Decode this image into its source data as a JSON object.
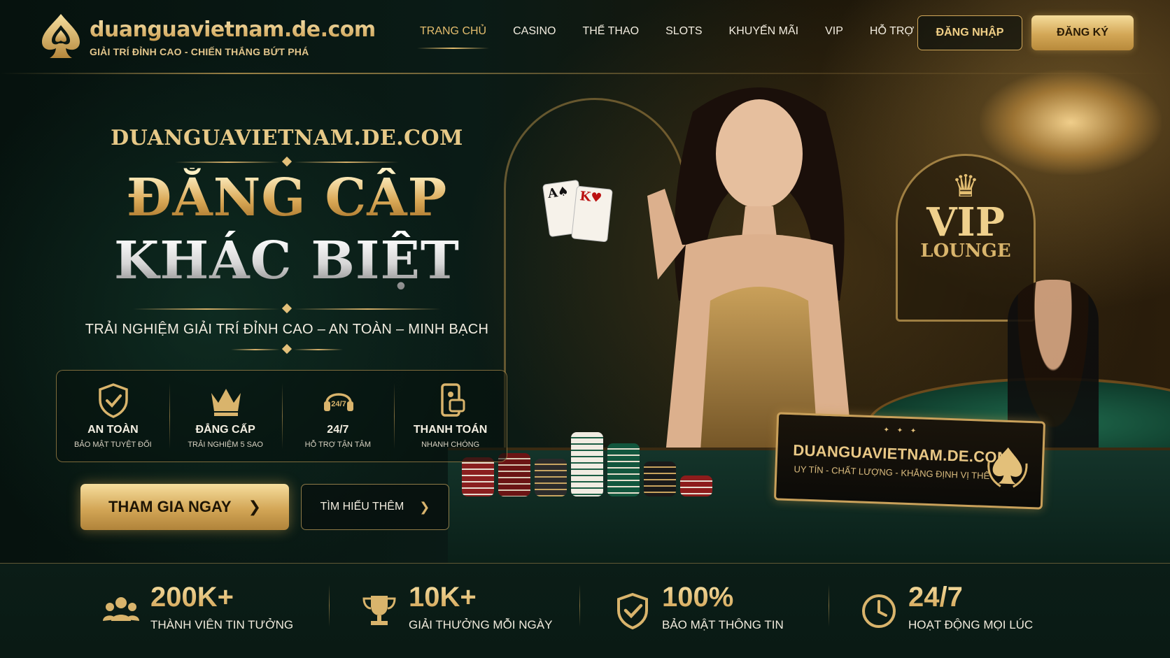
{
  "header": {
    "logo_title": "duanguavietnam.de.com",
    "logo_subtitle": "GIẢI TRÍ ĐỈNH CAO - CHIẾN THẮNG BỨT PHÁ",
    "nav": [
      {
        "label": "TRANG CHỦ",
        "active": true
      },
      {
        "label": "CASINO"
      },
      {
        "label": "THỂ THAO"
      },
      {
        "label": "SLOTS"
      },
      {
        "label": "KHUYẾN MÃI"
      },
      {
        "label": "VIP"
      },
      {
        "label": "HỖ TRỢ"
      }
    ],
    "login_label": "ĐĂNG NHẬP",
    "register_label": "ĐĂNG KÝ"
  },
  "hero": {
    "brand": "DUANGUAVIETNAM.DE.COM",
    "title_line1": "ĐẲNG CẤP",
    "title_line2": "KHÁC BIỆT",
    "tagline": "TRẢI NGHIỆM GIẢI TRÍ ĐỈNH CAO – AN TOÀN – MINH BẠCH",
    "features": [
      {
        "icon": "shield-check-icon",
        "title": "AN TOÀN",
        "subtitle": "BẢO MẬT TUYỆT ĐỐI"
      },
      {
        "icon": "crown-icon",
        "title": "ĐẲNG CẤP",
        "subtitle": "TRẢI NGHIỆM 5 SAO"
      },
      {
        "icon": "headset-24-7-icon",
        "title": "24/7",
        "subtitle": "HỖ TRỢ TẬN TÂM"
      },
      {
        "icon": "mobile-payment-icon",
        "title": "THANH TOÁN",
        "subtitle": "NHANH CHÓNG"
      }
    ],
    "join_label": "THAM GIA NGAY",
    "learn_more_label": "TÌM HIỂU THÊM"
  },
  "scene": {
    "vip_title": "VIP",
    "vip_subtitle": "LOUNGE",
    "name_tag": "duanguavietnam.de.com",
    "plaque_title": "DUANGUAVIETNAM.DE.COM",
    "plaque_subtitle": "UY TÍN - CHẤT LƯỢNG - KHẲNG ĐỊNH VỊ THẾ"
  },
  "stats": [
    {
      "icon": "users-icon",
      "value": "200K+",
      "label": "THÀNH VIÊN TIN TƯỞNG"
    },
    {
      "icon": "trophy-icon",
      "value": "10K+",
      "label": "GIẢI THƯỞNG MỖI NGÀY"
    },
    {
      "icon": "security-shield-icon",
      "value": "100%",
      "label": "BẢO MẬT THÔNG TIN"
    },
    {
      "icon": "clock-icon",
      "value": "24/7",
      "label": "HOẠT ĐỘNG MỌI LÚC"
    }
  ],
  "colors": {
    "gold": "#d6ac5e",
    "gold_light": "#f5dc9b",
    "dark_green": "#07130f"
  }
}
